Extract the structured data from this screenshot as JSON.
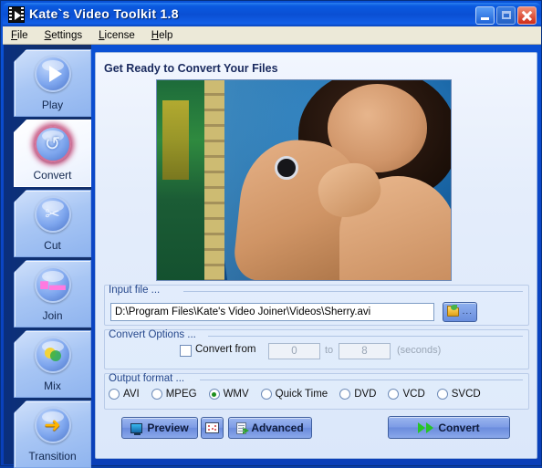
{
  "window": {
    "title": "Kate`s Video Toolkit 1.8",
    "app_icon": "film-play-icon",
    "controls": {
      "minimize": "minimize-icon",
      "maximize": "maximize-icon",
      "close": "close-icon"
    }
  },
  "menubar": {
    "items": [
      {
        "label": "File",
        "accel": "F"
      },
      {
        "label": "Settings",
        "accel": "S"
      },
      {
        "label": "License",
        "accel": "L"
      },
      {
        "label": "Help",
        "accel": "H"
      }
    ]
  },
  "sidebar": {
    "items": [
      {
        "label": "Play",
        "icon": "play-icon",
        "active": false
      },
      {
        "label": "Convert",
        "icon": "convert-arrows-icon",
        "active": true
      },
      {
        "label": "Cut",
        "icon": "scissors-icon",
        "active": false
      },
      {
        "label": "Join",
        "icon": "join-icon",
        "active": false
      },
      {
        "label": "Mix",
        "icon": "mix-circles-icon",
        "active": false
      },
      {
        "label": "Transition",
        "icon": "arrow-right-icon",
        "active": false
      }
    ]
  },
  "panel": {
    "title": "Get Ready to Convert Your Files",
    "preview": {
      "name": "video-preview"
    }
  },
  "input_file": {
    "group_label": "Input file ...",
    "path": "D:\\Program Files\\Kate's Video Joiner\\Videos\\Sherry.avi",
    "browse_label": "...",
    "browse_icon": "folder-open-icon"
  },
  "convert_options": {
    "group_label": "Convert Options ...",
    "checkbox_label": "Convert from",
    "checked": false,
    "from_value": "0",
    "to_label": "to",
    "to_value": "8",
    "units_label": "(seconds)",
    "enabled": false
  },
  "output_format": {
    "group_label": "Output format ...",
    "selected": "WMV",
    "options": [
      {
        "label": "AVI",
        "selected": false
      },
      {
        "label": "MPEG",
        "selected": false
      },
      {
        "label": "WMV",
        "selected": true
      },
      {
        "label": "Quick Time",
        "selected": false
      },
      {
        "label": "DVD",
        "selected": false
      },
      {
        "label": "VCD",
        "selected": false
      },
      {
        "label": "SVCD",
        "selected": false
      }
    ]
  },
  "actions": {
    "preview_label": "Preview",
    "preview_icon": "monitor-icon",
    "frames_icon": "filmstrip-icon",
    "advanced_label": "Advanced",
    "advanced_icon": "document-settings-icon",
    "convert_label": "Convert",
    "convert_icon": "fast-forward-icon"
  },
  "colors": {
    "window_frame": "#0a4fd4",
    "titlebar_text": "#ffffff",
    "sidebar_bg": "#12306e",
    "panel_bg": "#e4edfb",
    "group_label": "#25478c",
    "accent_green": "#1d8f1d",
    "close_red": "#cf2b18"
  }
}
